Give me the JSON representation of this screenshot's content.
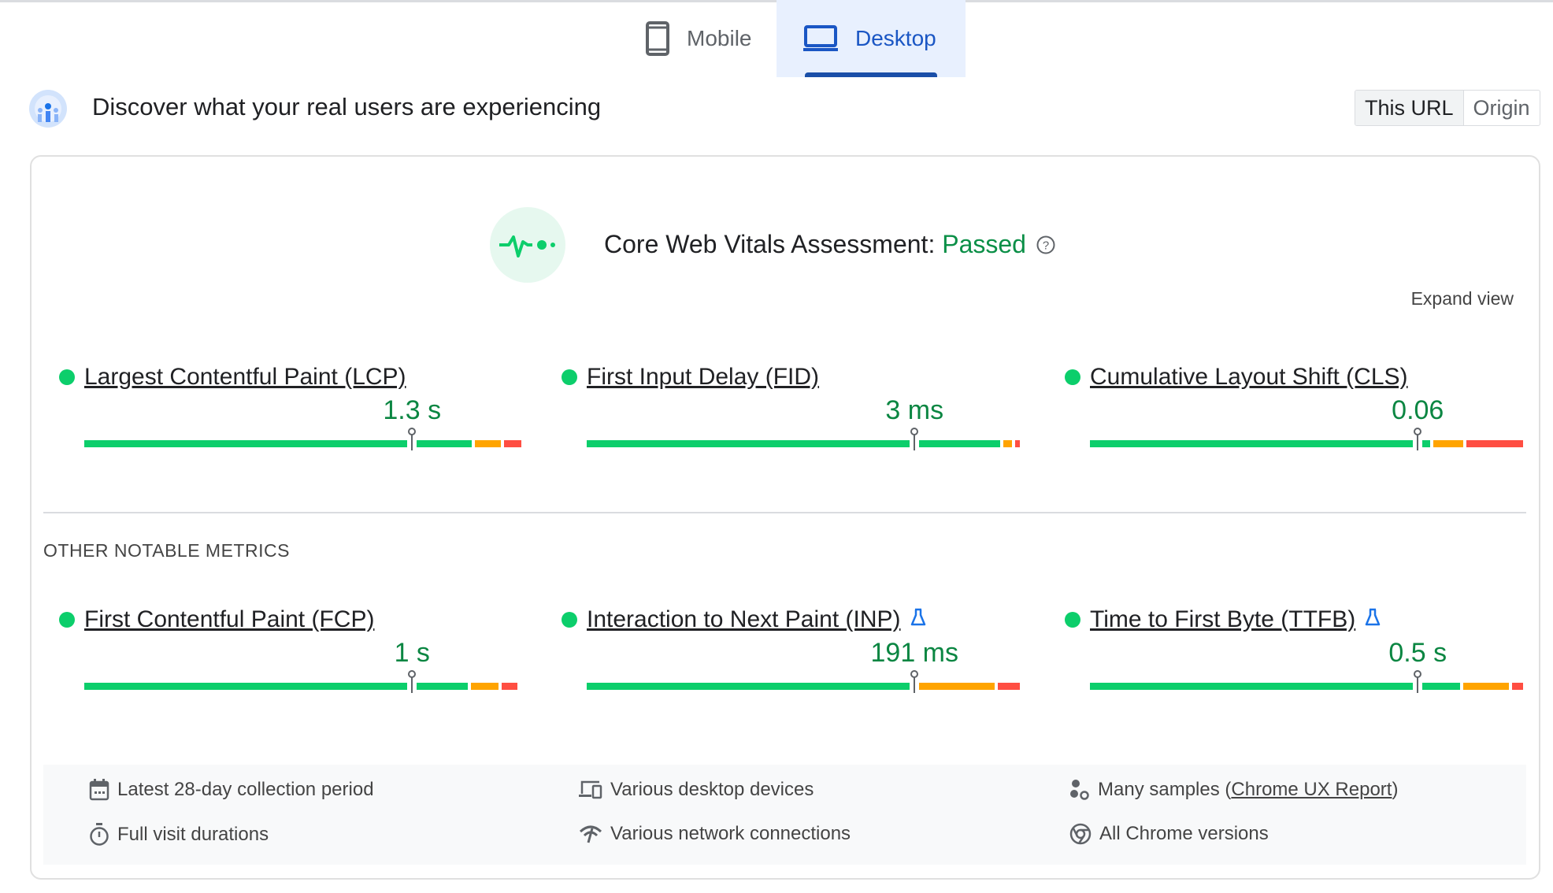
{
  "tabs": [
    {
      "label": "Mobile",
      "icon": "phone-icon",
      "active": false
    },
    {
      "label": "Desktop",
      "icon": "laptop-icon",
      "active": true
    }
  ],
  "header": {
    "title": "Discover what your real users are experiencing",
    "icon": "users-crux-icon"
  },
  "scope_toggle": {
    "options": [
      "This URL",
      "Origin"
    ],
    "selected": "This URL"
  },
  "assessment": {
    "title": "Core Web Vitals Assessment:",
    "status": "Passed",
    "help_icon": "help-icon",
    "expand_label": "Expand view"
  },
  "colors": {
    "good": "#0cce6b",
    "needs_improvement": "#ffa400",
    "poor": "#ff4e42",
    "value_text": "#0b8642",
    "accent": "#1a56c4"
  },
  "core_metrics": [
    {
      "label": "Largest Contentful Paint (LCP)",
      "value": "1.3 s",
      "distribution": [
        0.9,
        0.06,
        0.04
      ],
      "experimental": false
    },
    {
      "label": "First Input Delay (FID)",
      "value": "3 ms",
      "distribution": [
        0.96,
        0.02,
        0.01
      ],
      "experimental": false
    },
    {
      "label": "Cumulative Layout Shift (CLS)",
      "value": "0.06",
      "distribution": [
        0.79,
        0.07,
        0.13
      ],
      "experimental": false
    }
  ],
  "other_heading": "OTHER NOTABLE METRICS",
  "other_metrics": [
    {
      "label": "First Contentful Paint (FCP)",
      "value": "1 s",
      "distribution": [
        0.89,
        0.065,
        0.035
      ],
      "experimental": false
    },
    {
      "label": "Interaction to Next Paint (INP)",
      "value": "191 ms",
      "distribution": [
        0.75,
        0.19,
        0.05
      ],
      "experimental": true
    },
    {
      "label": "Time to First Byte (TTFB)",
      "value": "0.5 s",
      "distribution": [
        0.86,
        0.105,
        0.025
      ],
      "experimental": true
    }
  ],
  "marker_percentile": 0.75,
  "footer": {
    "period": "Latest 28-day collection period",
    "devices": "Various desktop devices",
    "samples_prefix": "Many samples (",
    "samples_link": "Chrome UX Report",
    "samples_suffix": ")",
    "durations": "Full visit durations",
    "network": "Various network connections",
    "chrome": "All Chrome versions"
  }
}
